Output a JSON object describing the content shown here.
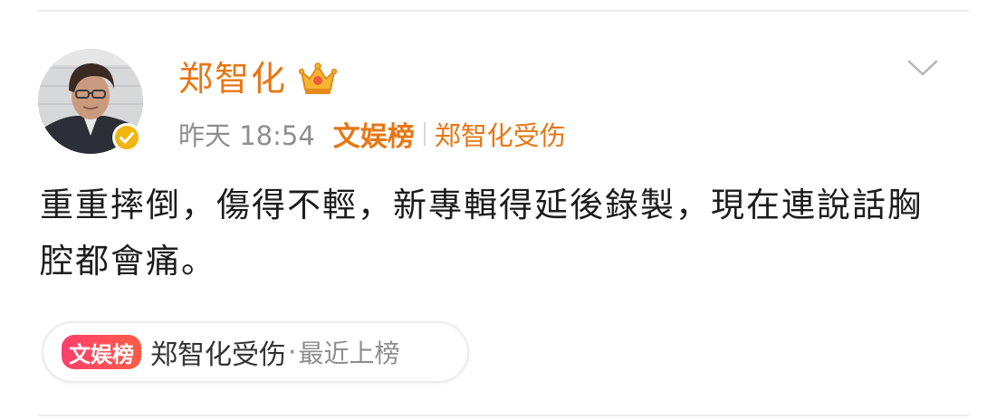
{
  "post": {
    "author": {
      "name": "郑智化",
      "verified": true,
      "member_badge": "crown-icon"
    },
    "meta": {
      "time": "昨天 18:54",
      "source": "文娱榜",
      "topic": "郑智化受伤"
    },
    "content": "重重摔倒，傷得不輕，新專輯得延後錄製，現在連說話胸腔都會痛。"
  },
  "topic_card": {
    "badge": "文娱榜",
    "topic": "郑智化受伤",
    "separator": "·",
    "status": "最近上榜"
  },
  "colors": {
    "accent_orange": "#e87613",
    "verified_yellow": "#f2b50f",
    "badge_red": "#ff3f6c",
    "text_main": "#1c1c1c",
    "text_muted": "#8e8e8e"
  }
}
